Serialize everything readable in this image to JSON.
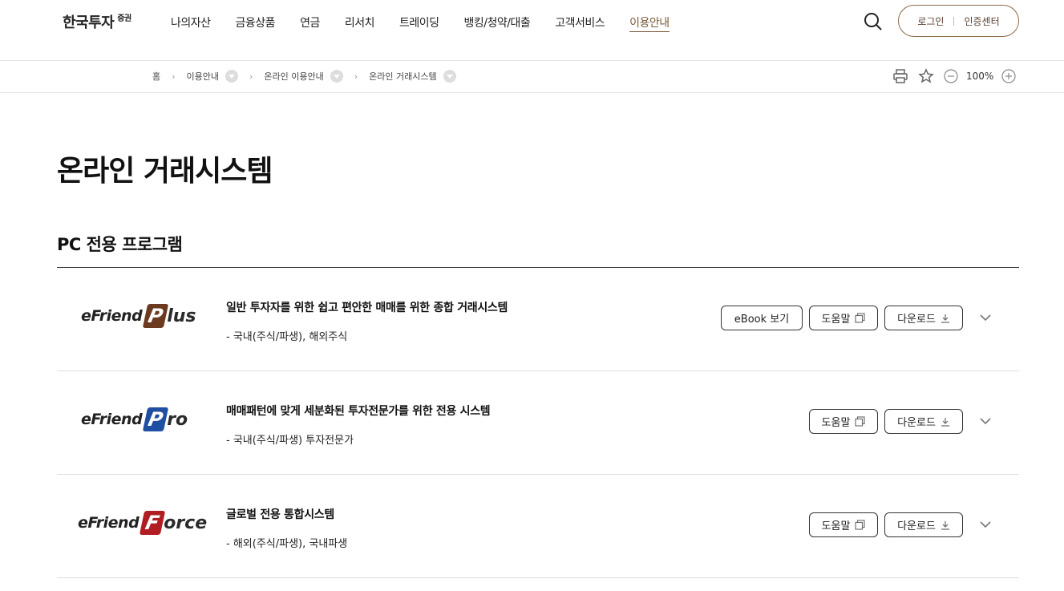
{
  "header": {
    "logo_text": "한국투자",
    "logo_sup": "증권",
    "nav": [
      "나의자산",
      "금융상품",
      "연금",
      "리서치",
      "트레이딩",
      "뱅킹/청약/대출",
      "고객서비스",
      "이용안내"
    ],
    "login": "로그인",
    "cert_center": "인증센터"
  },
  "breadcrumb": [
    "홈",
    "이용안내",
    "온라인 이용안내",
    "온라인 거래시스템"
  ],
  "tools": {
    "zoom": "100%"
  },
  "page": {
    "title": "온라인 거래시스템",
    "section_title": "PC 전용 프로그램"
  },
  "products": [
    {
      "logo_prefix": "eFriend",
      "logo_letter": "P",
      "logo_rest": "lus",
      "title": "일반 투자자를 위한 쉽고 편안한 매매를 위한 종합 거래시스템",
      "sub": "- 국내(주식/파생), 해외주식",
      "ebook": "eBook 보기",
      "help": "도움말",
      "download": "다운로드"
    },
    {
      "logo_prefix": "eFriend",
      "logo_letter": "P",
      "logo_rest": "ro",
      "title": "매매패턴에 맞게 세분화된 투자전문가를 위한 전용 시스템",
      "sub": "- 국내(주식/파생) 투자전문가",
      "help": "도움말",
      "download": "다운로드"
    },
    {
      "logo_prefix": "eFriend",
      "logo_letter": "F",
      "logo_rest": "orce",
      "title": "글로벌 전용 통합시스템",
      "sub": "- 해외(주식/파생), 국내파생",
      "help": "도움말",
      "download": "다운로드"
    }
  ],
  "colors": {
    "brand_brown": "#7a5a3a",
    "plus_logo": "#6b3a1f",
    "pro_logo": "#1f4fa0",
    "force_logo": "#b01e23"
  }
}
